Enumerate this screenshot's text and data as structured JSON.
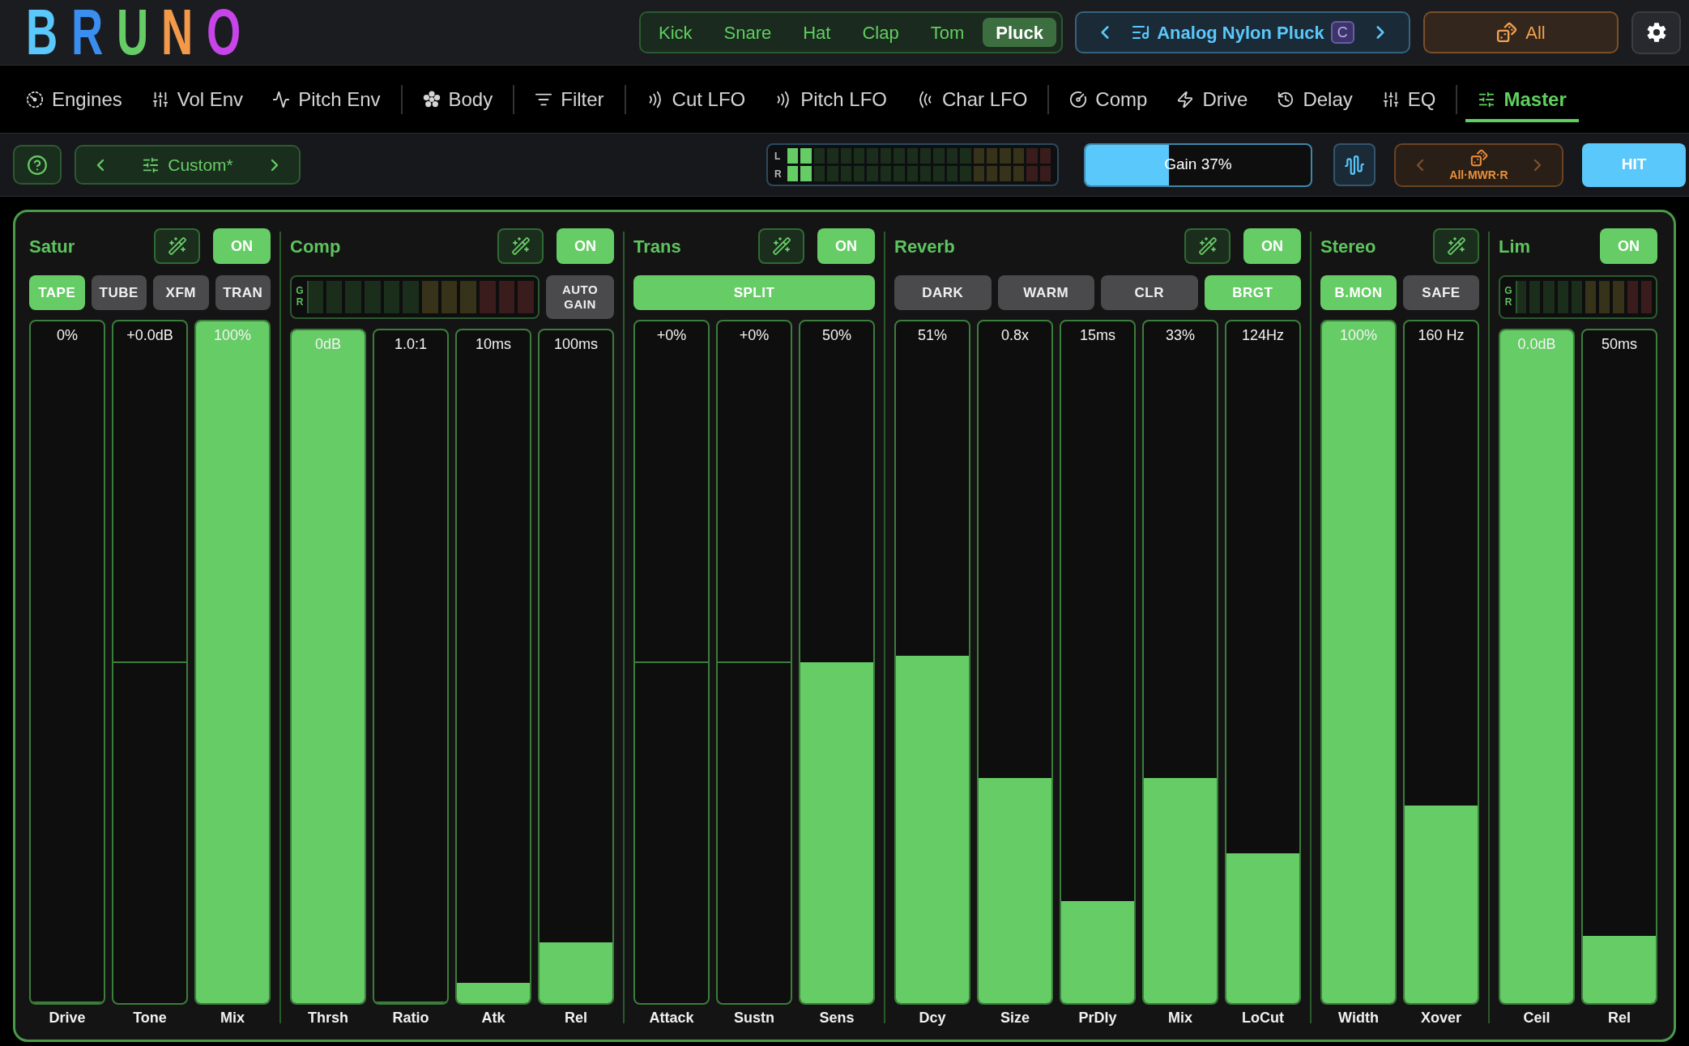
{
  "logo": [
    {
      "text": "B",
      "color": "#5ac8fa"
    },
    {
      "text": "R",
      "color": "#3a8ef0"
    },
    {
      "text": "U",
      "color": "#66cc66"
    },
    {
      "text": "N",
      "color": "#f29a4a"
    },
    {
      "text": "O",
      "color": "#c744e8"
    }
  ],
  "instrument_tabs": [
    {
      "label": "Kick",
      "selected": false
    },
    {
      "label": "Snare",
      "selected": false
    },
    {
      "label": "Hat",
      "selected": false
    },
    {
      "label": "Clap",
      "selected": false
    },
    {
      "label": "Tom",
      "selected": false
    },
    {
      "label": "Pluck",
      "selected": true
    }
  ],
  "preset": {
    "name": "Analog Nylon Pluck",
    "badge": "C"
  },
  "random_all_button": {
    "label": "All"
  },
  "nav_groups": [
    {
      "tabs": [
        {
          "label": "Engines",
          "selected": false
        },
        {
          "label": "Vol Env",
          "selected": false
        },
        {
          "label": "Pitch Env",
          "selected": false
        }
      ]
    },
    {
      "tabs": [
        {
          "label": "Body",
          "selected": false
        }
      ]
    },
    {
      "tabs": [
        {
          "label": "Filter",
          "selected": false
        }
      ]
    },
    {
      "tabs": [
        {
          "label": "Cut LFO",
          "selected": false
        },
        {
          "label": "Pitch LFO",
          "selected": false
        },
        {
          "label": "Char LFO",
          "selected": false
        }
      ]
    },
    {
      "tabs": [
        {
          "label": "Comp",
          "selected": false
        },
        {
          "label": "Drive",
          "selected": false
        },
        {
          "label": "Delay",
          "selected": false
        },
        {
          "label": "EQ",
          "selected": false
        }
      ]
    },
    {
      "tabs": [
        {
          "label": "Master",
          "selected": true
        }
      ]
    }
  ],
  "toolbar": {
    "preset_nav": {
      "label": "Custom*"
    },
    "output_meter": {
      "channels": [
        {
          "label": "L",
          "level": 0.1
        },
        {
          "label": "R",
          "level": 0.1
        }
      ]
    },
    "gain": {
      "label": "Gain 37%",
      "level": 0.37
    },
    "randomizer": {
      "label": "All·MWR·R"
    },
    "hit_button": {
      "label": "HIT"
    }
  },
  "sections": [
    {
      "title": "Satur",
      "wand": true,
      "power": {
        "label": "ON",
        "on": true
      },
      "controls": [
        {
          "kind": "option",
          "label": "TAPE",
          "selected": true
        },
        {
          "kind": "option",
          "label": "TUBE",
          "selected": false
        },
        {
          "kind": "option",
          "label": "XFM",
          "selected": false
        },
        {
          "kind": "option",
          "label": "TRAN",
          "selected": false
        }
      ],
      "faders": [
        {
          "kind": "unipolar",
          "value": "0%",
          "label": "Drive",
          "level": 0
        },
        {
          "kind": "bipolar",
          "value": "+0.0dB",
          "label": "Tone",
          "level": 0.5
        },
        {
          "kind": "unipolar",
          "value": "100%",
          "label": "Mix",
          "level": 1
        }
      ]
    },
    {
      "title": "Comp",
      "wand": true,
      "power": {
        "label": "ON",
        "on": true
      },
      "controls": [
        {
          "kind": "meter",
          "label": "GR",
          "level": 0
        },
        {
          "kind": "option",
          "label": "AUTO GAIN",
          "selected": false
        }
      ],
      "faders": [
        {
          "kind": "unipolar",
          "value": "0dB",
          "label": "Thrsh",
          "level": 1
        },
        {
          "kind": "unipolar",
          "value": "1.0:1",
          "label": "Ratio",
          "level": 0
        },
        {
          "kind": "unipolar",
          "value": "10ms",
          "label": "Atk",
          "level": 0.03
        },
        {
          "kind": "unipolar",
          "value": "100ms",
          "label": "Rel",
          "level": 0.09
        }
      ]
    },
    {
      "title": "Trans",
      "wand": true,
      "power": {
        "label": "ON",
        "on": true
      },
      "controls": [
        {
          "kind": "option",
          "label": "SPLIT",
          "selected": true
        }
      ],
      "faders": [
        {
          "kind": "bipolar",
          "value": "+0%",
          "label": "Attack",
          "level": 0.5
        },
        {
          "kind": "bipolar",
          "value": "+0%",
          "label": "Sustn",
          "level": 0.5
        },
        {
          "kind": "unipolar",
          "value": "50%",
          "label": "Sens",
          "level": 0.5
        }
      ]
    },
    {
      "title": "Reverb",
      "wand": true,
      "power": {
        "label": "ON",
        "on": true
      },
      "controls": [
        {
          "kind": "option",
          "label": "DARK",
          "selected": false
        },
        {
          "kind": "option",
          "label": "WARM",
          "selected": false
        },
        {
          "kind": "option",
          "label": "CLR",
          "selected": false
        },
        {
          "kind": "option",
          "label": "BRGT",
          "selected": true
        }
      ],
      "faders": [
        {
          "kind": "unipolar",
          "value": "51%",
          "label": "Dcy",
          "level": 0.51
        },
        {
          "kind": "unipolar",
          "value": "0.8x",
          "label": "Size",
          "level": 0.33
        },
        {
          "kind": "unipolar",
          "value": "15ms",
          "label": "PrDly",
          "level": 0.15
        },
        {
          "kind": "unipolar",
          "value": "33%",
          "label": "Mix",
          "level": 0.33
        },
        {
          "kind": "unipolar",
          "value": "124Hz",
          "label": "LoCut",
          "level": 0.22
        }
      ]
    },
    {
      "title": "Stereo",
      "wand": true,
      "controls": [
        {
          "kind": "option",
          "label": "B.MON",
          "selected": true
        },
        {
          "kind": "option",
          "label": "SAFE",
          "selected": false
        }
      ],
      "faders": [
        {
          "kind": "unipolar",
          "value": "100%",
          "label": "Width",
          "level": 1
        },
        {
          "kind": "unipolar",
          "value": "160 Hz",
          "label": "Xover",
          "level": 0.29
        }
      ]
    },
    {
      "title": "Lim",
      "power": {
        "label": "ON",
        "on": true
      },
      "controls": [
        {
          "kind": "meter",
          "label": "GR",
          "level": 0
        }
      ],
      "faders": [
        {
          "kind": "unipolar",
          "value": "0.0dB",
          "label": "Ceil",
          "level": 1
        },
        {
          "kind": "unipolar",
          "value": "50ms",
          "label": "Rel",
          "level": 0.1
        }
      ]
    }
  ]
}
